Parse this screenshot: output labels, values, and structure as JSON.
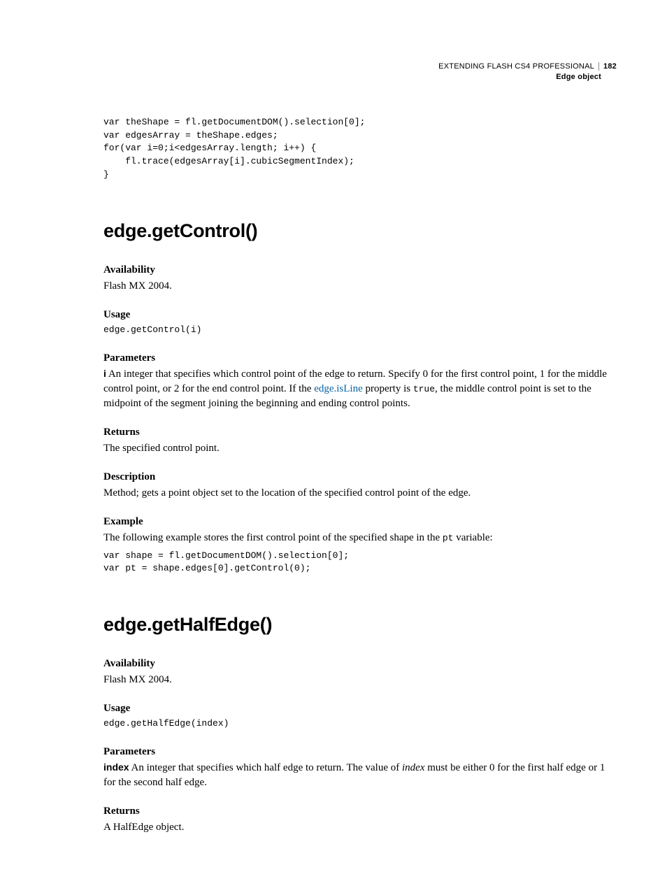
{
  "header": {
    "book_title": "EXTENDING FLASH CS4 PROFESSIONAL",
    "page_number": "182",
    "section": "Edge object"
  },
  "top_code": "var theShape = fl.getDocumentDOM().selection[0];\nvar edgesArray = theShape.edges;\nfor(var i=0;i<edgesArray.length; i++) {\n    fl.trace(edgesArray[i].cubicSegmentIndex);\n}",
  "m1": {
    "title": "edge.getControl()",
    "availability_label": "Availability",
    "availability_text": "Flash MX 2004.",
    "usage_label": "Usage",
    "usage_code": "edge.getControl(i)",
    "params_label": "Parameters",
    "param_name": "i",
    "param_text_before_link": "  An integer that specifies which control point of the edge to return. Specify 0 for the first control point, 1 for the middle control point, or 2 for the end control point. If the ",
    "param_link_text": "edge.isLine",
    "param_text_after_link_1": " property is ",
    "param_code_true": "true",
    "param_text_after_link_2": ", the middle control point is set to the midpoint of the segment joining the beginning and ending control points.",
    "returns_label": "Returns",
    "returns_text": "The specified control point.",
    "description_label": "Description",
    "description_text": "Method; gets a point object set to the location of the specified control point of the edge.",
    "example_label": "Example",
    "example_text_before_code": "The following example stores the first control point of the specified shape in the ",
    "example_inline_code": "pt",
    "example_text_after_code": " variable:",
    "example_code": "var shape = fl.getDocumentDOM().selection[0];\nvar pt = shape.edges[0].getControl(0);"
  },
  "m2": {
    "title": "edge.getHalfEdge()",
    "availability_label": "Availability",
    "availability_text": "Flash MX 2004.",
    "usage_label": "Usage",
    "usage_code": "edge.getHalfEdge(index)",
    "params_label": "Parameters",
    "param_name": "index",
    "param_text_1": "  An integer that specifies which half edge to return. The value of ",
    "param_ital": "index",
    "param_text_2": " must be either 0 for the first half edge or 1 for the second half edge.",
    "returns_label": "Returns",
    "returns_text": "A HalfEdge object."
  }
}
